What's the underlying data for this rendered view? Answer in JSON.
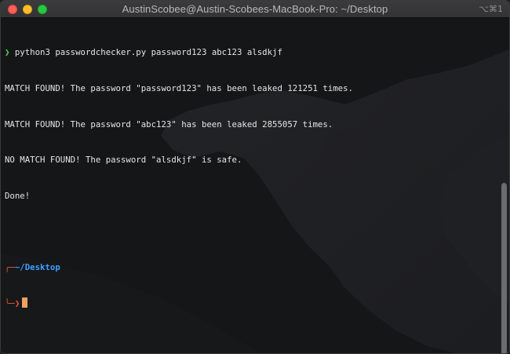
{
  "window": {
    "title": "AustinScobee@Austin-Scobees-MacBook-Pro: ~/Desktop",
    "shortcut": "⌥⌘1"
  },
  "terminal": {
    "prompt_symbol": "❯",
    "command": "python3 passwordchecker.py password123 abc123 alsdkjf",
    "output": [
      "MATCH FOUND! The password \"password123\" has been leaked 121251 times.",
      "MATCH FOUND! The password \"abc123\" has been leaked 2855057 times.",
      "NO MATCH FOUND! The password \"alsdkjf\" is safe.",
      "Done!"
    ],
    "cwd": "~/Desktop",
    "corner_top": "╭─",
    "corner_bottom": "╰─",
    "caret": "❯"
  }
}
